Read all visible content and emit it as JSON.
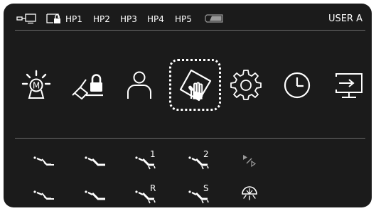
{
  "status_bar": {
    "handpieces": [
      "HP1",
      "HP2",
      "HP3",
      "HP4",
      "HP5"
    ],
    "user": "USER A",
    "icons": [
      "monitor-link-icon",
      "lock-screen-icon",
      "battery-icon"
    ]
  },
  "main_menu": {
    "items": [
      {
        "icon": "operating-light-m-icon",
        "selected": false
      },
      {
        "icon": "locked-instrument-icon",
        "selected": false
      },
      {
        "icon": "user-profile-icon",
        "selected": false
      },
      {
        "icon": "hygiene-hand-icon",
        "selected": true
      },
      {
        "icon": "settings-gear-icon",
        "selected": false
      },
      {
        "icon": "clock-icon",
        "selected": false
      },
      {
        "icon": "screen-input-icon",
        "selected": false
      }
    ]
  },
  "instrument_grid": {
    "row1": [
      {
        "icon": "handpiece-1-icon",
        "tag": ""
      },
      {
        "icon": "handpiece-2-icon",
        "tag": ""
      },
      {
        "icon": "handpiece-slot-icon",
        "tag": "1"
      },
      {
        "icon": "handpiece-slot-icon",
        "tag": "2"
      },
      {
        "icon": "play-step-icon",
        "tag": ""
      }
    ],
    "row2": [
      {
        "icon": "handpiece-3-icon",
        "tag": ""
      },
      {
        "icon": "handpiece-4-icon",
        "tag": ""
      },
      {
        "icon": "handpiece-slot-icon",
        "tag": "R"
      },
      {
        "icon": "handpiece-slot-icon",
        "tag": "S"
      },
      {
        "icon": "curing-light-icon",
        "tag": ""
      }
    ]
  }
}
